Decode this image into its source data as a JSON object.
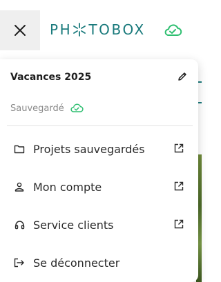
{
  "header": {
    "close_icon": "close-icon",
    "logo_text_before": "PH",
    "logo_text_after": "TOBOX",
    "logo_star_icon": "star-logo-icon",
    "cloud_icon": "cloud-check-icon",
    "brand_color": "#1a7a7c",
    "cloud_color": "#2fbf71"
  },
  "project": {
    "title": "Vacances 2025",
    "edit_icon": "pencil-icon",
    "status": "Sauvegardé",
    "status_icon": "cloud-check-icon"
  },
  "menu": {
    "items": [
      {
        "label": "Projets sauvegardés",
        "icon": "folder-icon",
        "external_icon": "external-link-icon"
      },
      {
        "label": "Mon compte",
        "icon": "user-icon",
        "external_icon": "external-link-icon"
      },
      {
        "label": "Service clients",
        "icon": "headset-icon",
        "external_icon": "external-link-icon"
      },
      {
        "label": "Se déconnecter",
        "icon": "logout-icon"
      }
    ]
  }
}
